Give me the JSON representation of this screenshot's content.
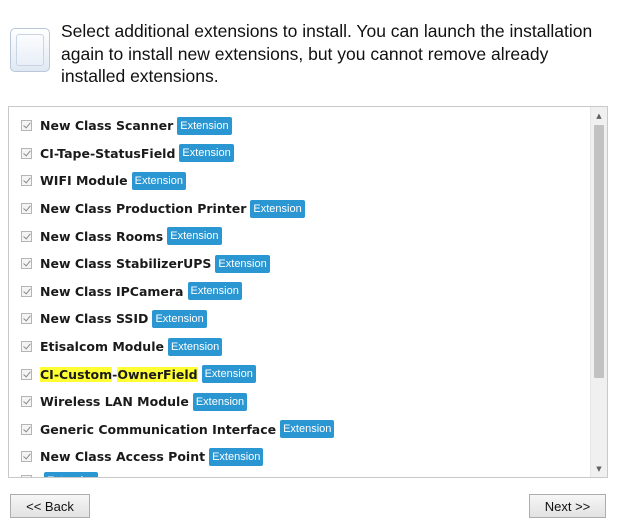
{
  "header": {
    "text": "Select additional extensions to install. You can launch the installation again to install new extensions, but you cannot remove already installed extensions."
  },
  "extensions": [
    {
      "pre": "",
      "hl": "",
      "mid": "",
      "hl2": "",
      "post": "New Class Scanner",
      "badge": "Extension"
    },
    {
      "pre": "",
      "hl": "",
      "mid": "",
      "hl2": "",
      "post": "CI-Tape-StatusField",
      "badge": "Extension"
    },
    {
      "pre": "",
      "hl": "",
      "mid": "",
      "hl2": "",
      "post": "WIFI Module",
      "badge": "Extension"
    },
    {
      "pre": "",
      "hl": "",
      "mid": "",
      "hl2": "",
      "post": "New Class Production Printer",
      "badge": "Extension"
    },
    {
      "pre": "",
      "hl": "",
      "mid": "",
      "hl2": "",
      "post": "New Class Rooms",
      "badge": "Extension"
    },
    {
      "pre": "",
      "hl": "",
      "mid": "",
      "hl2": "",
      "post": "New Class StabilizerUPS",
      "badge": "Extension"
    },
    {
      "pre": "",
      "hl": "",
      "mid": "",
      "hl2": "",
      "post": "New Class IPCamera",
      "badge": "Extension"
    },
    {
      "pre": "",
      "hl": "",
      "mid": "",
      "hl2": "",
      "post": "New Class SSID",
      "badge": "Extension"
    },
    {
      "pre": "",
      "hl": "",
      "mid": "",
      "hl2": "",
      "post": "Etisalcom Module",
      "badge": "Extension"
    },
    {
      "pre": "",
      "hl": "CI-Custom",
      "mid": "-",
      "hl2": "OwnerField",
      "post": "",
      "badge": "Extension"
    },
    {
      "pre": "",
      "hl": "",
      "mid": "",
      "hl2": "",
      "post": "Wireless LAN Module",
      "badge": "Extension"
    },
    {
      "pre": "",
      "hl": "",
      "mid": "",
      "hl2": "",
      "post": "Generic Communication Interface",
      "badge": "Extension"
    },
    {
      "pre": "",
      "hl": "",
      "mid": "",
      "hl2": "",
      "post": "New Class Access Point",
      "badge": "Extension"
    },
    {
      "pre": "",
      "hl": "",
      "mid": "",
      "hl2": "",
      "post": "",
      "badge": "Extension"
    }
  ],
  "checked": true,
  "scrollbar": {
    "up_glyph": "▲",
    "down_glyph": "▼"
  },
  "buttons": {
    "back": "<< Back",
    "next": "Next >>"
  },
  "colors": {
    "badge": "#2a96d2",
    "highlight": "#ffff33"
  }
}
